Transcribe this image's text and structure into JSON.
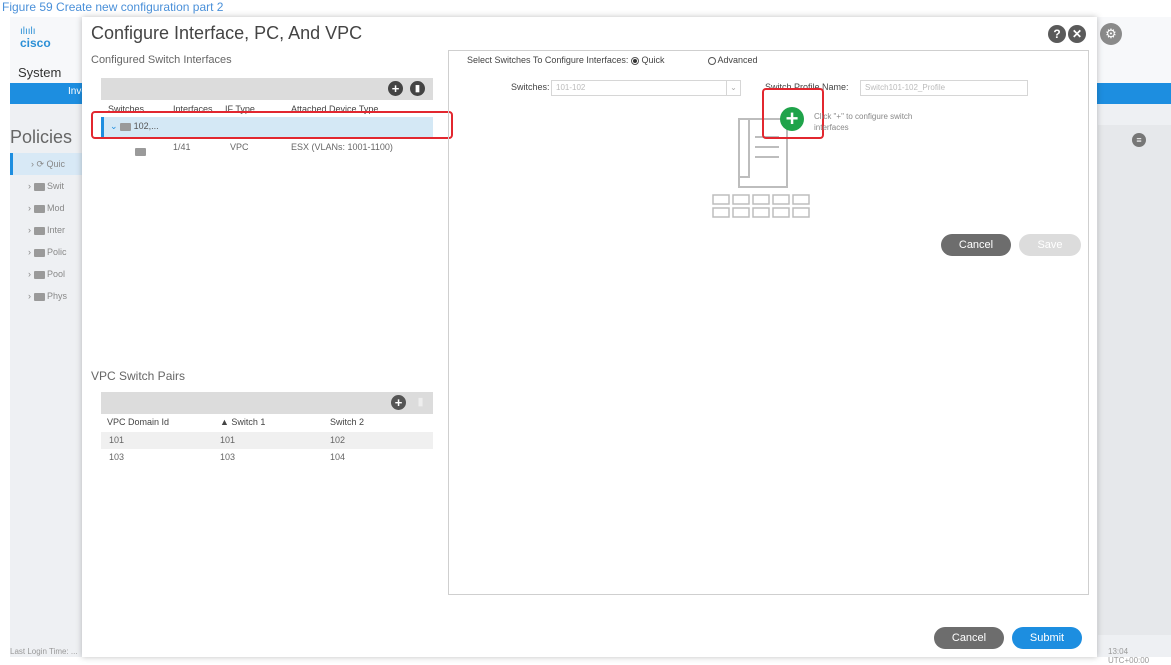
{
  "caption": "Figure 59 Create new configuration part 2",
  "background": {
    "logo_word": "cisco",
    "logo_bars": "ılıılı",
    "system_label": "System",
    "nav_partial": "Inve",
    "policies_label": "Policies",
    "tree_items": [
      "Quic",
      "Swit",
      "Mod",
      "Inter",
      "Polic",
      "Pool",
      "Phys"
    ],
    "footer_left": "Last Login Time: ...",
    "footer_right": "13:04 UTC+00:00",
    "gear_icon": "gear-icon",
    "list_icon": "list-icon"
  },
  "modal": {
    "title": "Configure Interface, PC, And VPC",
    "help_icon_glyph": "?",
    "close_icon_glyph": "✕",
    "configured_label": "Configured Switch Interfaces",
    "interfaces_table": {
      "columns": [
        "Switches",
        "Interfaces",
        "IF Type",
        "Attached Device Type"
      ],
      "selected_row_label": "102,...",
      "rows": [
        {
          "interfaces": "1/41",
          "if_type": "VPC",
          "device_type": "ESX (VLANs: 1001-1100)"
        }
      ]
    },
    "vpc_label": "VPC Switch Pairs",
    "vpc_table": {
      "columns": [
        "VPC Domain Id",
        "▲ Switch 1",
        "Switch 2"
      ],
      "rows": [
        {
          "domain": "101",
          "switch1": "101",
          "switch2": "102"
        },
        {
          "domain": "103",
          "switch1": "103",
          "switch2": "104"
        }
      ]
    },
    "select_label": "Select Switches To Configure Interfaces:",
    "radio_quick": "Quick",
    "radio_advanced": "Advanced",
    "switches_label": "Switches:",
    "switches_value": "101-102",
    "profile_label": "Switch Profile Name:",
    "profile_value": "Switch101-102_Profile",
    "hint_line1": "Click \"+\" to configure switch",
    "hint_line2": "interfaces",
    "cancel_inner": "Cancel",
    "save": "Save",
    "cancel": "Cancel",
    "submit": "Submit",
    "colors": {
      "accent": "#1d8ee0",
      "green": "#1fa34a",
      "highlight": "#e2272f"
    }
  }
}
